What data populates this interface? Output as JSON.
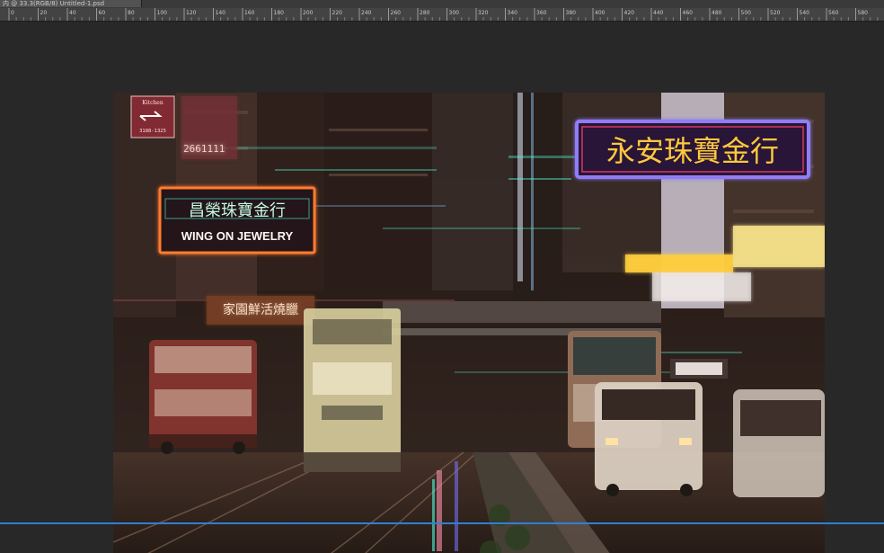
{
  "document": {
    "tab_label": "内 @ 33.3(RGB/8) Untitled-1.psd"
  },
  "ruler": {
    "marks": [
      "0",
      "20",
      "40",
      "60",
      "80",
      "100",
      "120",
      "140",
      "160",
      "180",
      "200",
      "220",
      "240",
      "260",
      "280",
      "300",
      "320",
      "340",
      "360",
      "380",
      "400",
      "420",
      "440",
      "460",
      "480",
      "500",
      "520",
      "540",
      "560",
      "580"
    ]
  },
  "photo": {
    "signs": {
      "jewelry_en": "WING ON JEWELRY",
      "jewelry_zh": "永安珠寶金行",
      "zh_left": "家園鮮活燒臘",
      "zh_right": "昌榮珠寶金行",
      "phone": "2661111",
      "kitchen": "Kitchen",
      "kitchen_phone": "3188-1325"
    }
  },
  "colors": {
    "guide": "#2f7fd6",
    "neon_red": "#ff2a4d",
    "neon_yellow": "#ffe15a",
    "neon_cyan": "#45ffe0",
    "neon_blue": "#6a6cff"
  }
}
